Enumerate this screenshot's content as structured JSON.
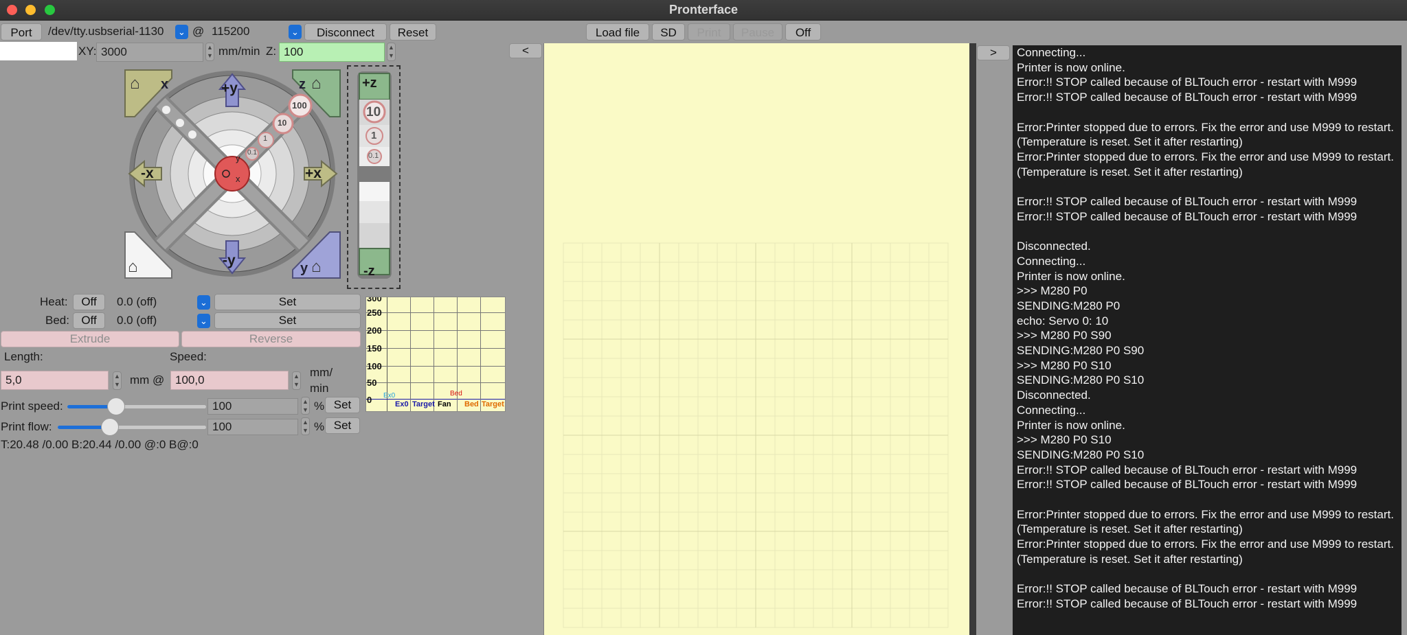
{
  "window": {
    "title": "Pronterface"
  },
  "toolbar": {
    "port_label": "Port",
    "port_value": "/dev/tty.usbserial-1130",
    "at_label": "@",
    "baud_value": "115200",
    "disconnect_label": "Disconnect",
    "reset_label": "Reset",
    "load_file_label": "Load file",
    "sd_label": "SD",
    "print_label": "Print",
    "pause_label": "Pause",
    "off_label": "Off",
    "collapse_left_label": "<",
    "collapse_right_label": ">"
  },
  "feed": {
    "xy_label": "XY:",
    "xy_value": "3000",
    "unit_label": "mm/min",
    "z_label": "Z:",
    "z_value": "100"
  },
  "jog": {
    "plus_y": "+y",
    "minus_y": "-y",
    "plus_x": "+x",
    "minus_x": "-x",
    "home_x": "x",
    "home_z": "z",
    "home_y": "y",
    "step_100": "100",
    "step_10": "10",
    "step_1": "1",
    "step_01": "0.1",
    "plus_z": "+z",
    "minus_z": "-z",
    "z_step_10": "10",
    "z_step_1": "1",
    "z_step_01": "0.1"
  },
  "temps": {
    "heat_label": "Heat:",
    "heat_off": "Off",
    "heat_value": "0.0 (off)",
    "heat_set": "Set",
    "bed_label": "Bed:",
    "bed_off": "Off",
    "bed_value": "0.0 (off)",
    "bed_set": "Set"
  },
  "extrude": {
    "extrude_label": "Extrude",
    "reverse_label": "Reverse",
    "length_label": "Length:",
    "length_value": "5,0",
    "mm_at": "mm @",
    "speed_label": "Speed:",
    "speed_value": "100,0",
    "speed_unit_1": "mm/",
    "speed_unit_2": "min"
  },
  "print_controls": {
    "speed_label": "Print speed:",
    "speed_value": "100",
    "speed_fraction": 0.35,
    "flow_label": "Print flow:",
    "flow_value": "100",
    "flow_fraction": 0.35,
    "percent": "%",
    "set_label": "Set"
  },
  "status_line": "T:20.48 /0.00 B:20.44 /0.00 @:0 B@:0",
  "graph": {
    "y_ticks": [
      "300",
      "250",
      "200",
      "150",
      "100",
      "50",
      "0"
    ],
    "legend": [
      "Ex0",
      "Target",
      "Fan",
      "Bed",
      "Target"
    ],
    "top_labels": [
      "Ex0",
      "Bed"
    ],
    "colors": {
      "ex0": "#1a1aa8",
      "target": "#1a1aa8",
      "fan": "#000000",
      "bed": "#e06a00",
      "bed_top": "#d81010",
      "ex0_top": "#1ea0e0"
    }
  },
  "log_lines": [
    "Connecting...",
    "Printer is now online.",
    "Error:!! STOP called because of BLTouch error - restart with M999",
    "Error:!! STOP called because of BLTouch error - restart with M999",
    "",
    "Error:Printer stopped due to errors. Fix the error and use M999 to restart. (Temperature is reset. Set it after restarting)",
    "Error:Printer stopped due to errors. Fix the error and use M999 to restart. (Temperature is reset. Set it after restarting)",
    "",
    "Error:!! STOP called because of BLTouch error - restart with M999",
    "Error:!! STOP called because of BLTouch error - restart with M999",
    "",
    "Disconnected.",
    "Connecting...",
    "Printer is now online.",
    ">>> M280 P0",
    "SENDING:M280 P0",
    "echo: Servo 0: 10",
    ">>> M280 P0 S90",
    "SENDING:M280 P0 S90",
    ">>> M280 P0 S10",
    "SENDING:M280 P0 S10",
    "Disconnected.",
    "Connecting...",
    "Printer is now online.",
    ">>> M280 P0 S10",
    "SENDING:M280 P0 S10",
    "Error:!! STOP called because of BLTouch error - restart with M999",
    "Error:!! STOP called because of BLTouch error - restart with M999",
    "",
    "Error:Printer stopped due to errors. Fix the error and use M999 to restart. (Temperature is reset. Set it after restarting)",
    "Error:Printer stopped due to errors. Fix the error and use M999 to restart. (Temperature is reset. Set it after restarting)",
    "",
    "Error:!! STOP called because of BLTouch error - restart with M999",
    "Error:!! STOP called because of BLTouch error - restart with M999"
  ]
}
